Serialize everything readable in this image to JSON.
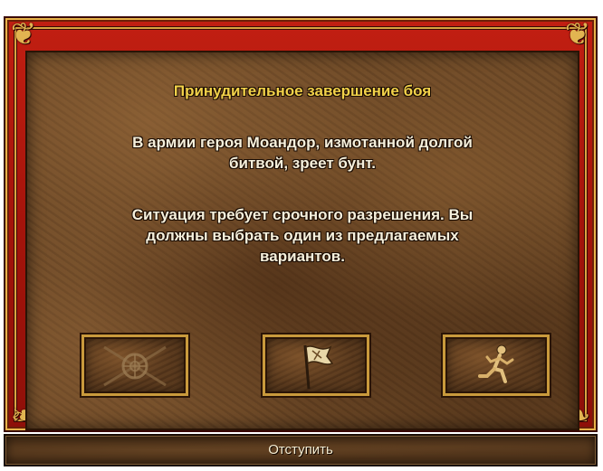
{
  "dialog": {
    "title": "Принудительное завершение боя",
    "message_line1": "В армии героя Моандор, измотанной долгой\nбитвой, зреет бунт.",
    "message_line2": "Ситуация требует срочного разрешения. Вы\nдолжны выбрать один из предлагаемых\nвариантов."
  },
  "options": [
    {
      "icon": "broken-sword-shield-icon"
    },
    {
      "icon": "white-flag-icon"
    },
    {
      "icon": "running-man-icon"
    }
  ],
  "status_bar": {
    "text": "Отступить"
  },
  "colors": {
    "frame_red": "#c21f12",
    "gold_trim": "#d9a441",
    "title_yellow": "#f2d24a",
    "text_white": "#f6f0dc",
    "leather": "#6e4a28"
  }
}
